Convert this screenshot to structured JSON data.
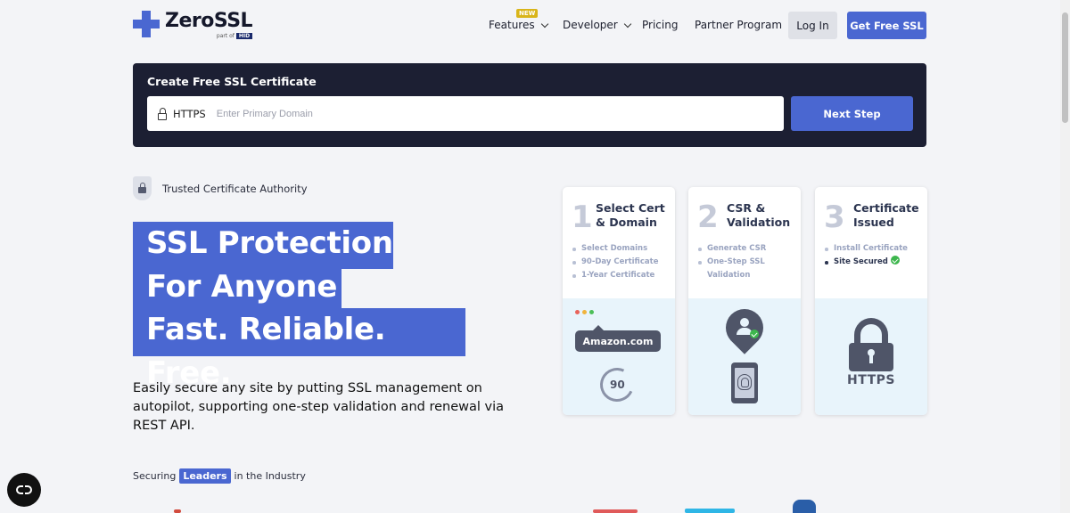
{
  "brand": {
    "name": "ZeroSSL",
    "sub_prefix": "part of",
    "sub_badge": "HID",
    "color": "#4a67d1"
  },
  "nav": {
    "features": "Features",
    "features_badge": "NEW",
    "developer": "Developer",
    "pricing": "Pricing",
    "partner": "Partner Program",
    "login": "Log In",
    "get_ssl": "Get Free SSL"
  },
  "create": {
    "title": "Create Free SSL Certificate",
    "protocol": "HTTPS",
    "placeholder": "Enter Primary Domain",
    "value": "",
    "next_button": "Next Step"
  },
  "trusted": "Trusted Certificate Authority",
  "hero": {
    "line1": "SSL Protection",
    "line2": "For Anyone",
    "line3": "Fast. Reliable. Free.",
    "description": "Easily secure any site by putting SSL management on autopilot, supporting one-step validation and renewal via REST API."
  },
  "steps": [
    {
      "number": "1",
      "title": "Select Cert\n& Domain",
      "items": [
        "Select Domains",
        "90-Day Certificate",
        "1-Year Certificate"
      ],
      "illustration_text": "Amazon.com",
      "illustration_number": "90"
    },
    {
      "number": "2",
      "title": "CSR &\nValidation",
      "items": [
        "Generate CSR",
        "One-Step SSL\nValidation"
      ]
    },
    {
      "number": "3",
      "title": "Certificate\nIssued",
      "items": [
        "Install Certificate",
        "Site Secured"
      ],
      "illustration_text": "HTTPS"
    }
  ],
  "securing": {
    "prefix": "Securing",
    "highlight": "Leaders",
    "suffix": "in the Industry"
  },
  "icons": {
    "logo": "zerossl-cross-icon",
    "lock": "lock-icon",
    "shield": "shield-lock-icon",
    "chat": "chat-widget-icon"
  }
}
